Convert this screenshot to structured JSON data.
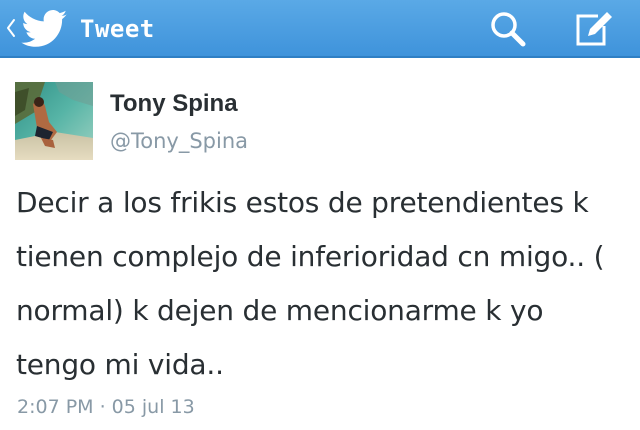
{
  "action_bar": {
    "title": "Tweet",
    "app_icon": "twitter-bird-icon",
    "up_icon": "chevron-left-icon",
    "actions": [
      {
        "name": "search",
        "icon": "search-icon"
      },
      {
        "name": "compose",
        "icon": "compose-icon"
      }
    ],
    "colors": {
      "bar": "#4a9fe2",
      "bar_dark": "#2f7fc4",
      "icon": "#ffffff"
    }
  },
  "tweet": {
    "author_name": "Tony Spina",
    "author_handle": "@Tony_Spina",
    "text_lines": [
      "Decir a los frikis estos de pretendientes k",
      "tienen complejo de inferioridad cn migo.. (",
      "normal) k dejen de mencionarme k yo",
      "tengo mi vida.."
    ],
    "timestamp": "2:07 PM · 05 jul 13",
    "colors": {
      "name": "#292f33",
      "meta": "#8899a6"
    }
  }
}
